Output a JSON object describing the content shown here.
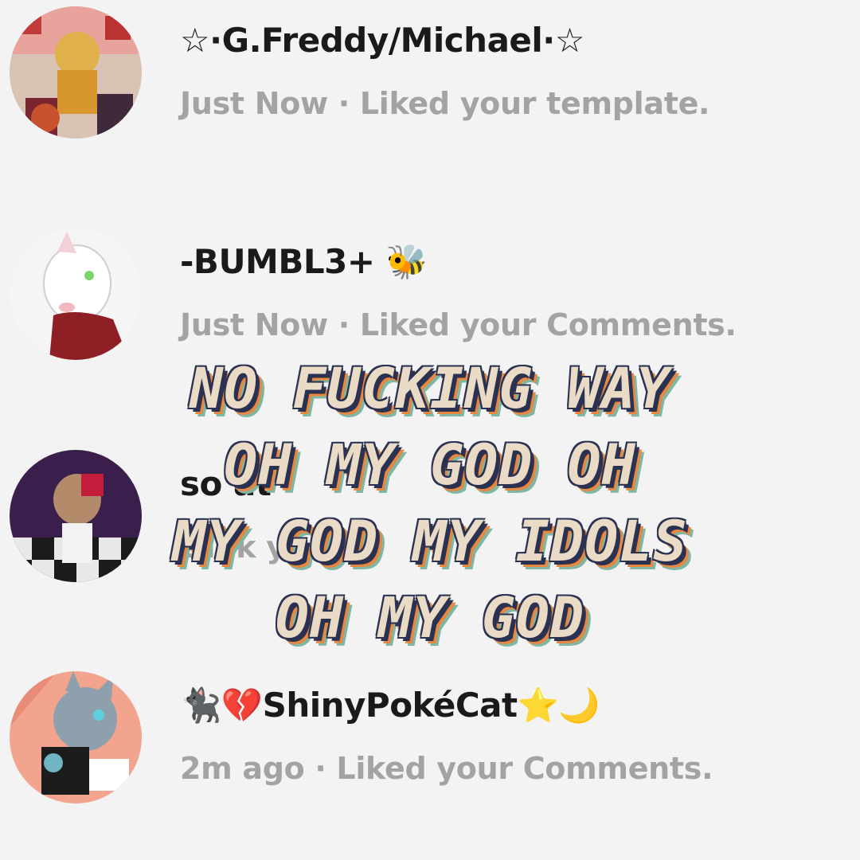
{
  "notifications": [
    {
      "name": "☆·G.Freddy/Michael·☆",
      "meta": "Just Now · Liked your template.",
      "avatar_icon": "avatar-freddy-image"
    },
    {
      "name": "-BUMBL3+ 🐝",
      "meta": "Just Now · Liked your Comments.",
      "avatar_icon": "avatar-white-cat-image"
    },
    {
      "name": "so at",
      "meta": "t I ik yo .",
      "avatar_icon": "avatar-masked-character-image"
    },
    {
      "name": "🐈‍⬛💔ShinyPokéCat⭐🌙",
      "meta": "2m ago · Liked your Comments.",
      "avatar_icon": "avatar-gray-cat-image"
    }
  ],
  "overlay_caption": {
    "lines": [
      "NO FUCKING WAY",
      "OH MY GOD OH",
      "MY GOD MY IDOLS",
      "OH MY GOD"
    ],
    "fill_color": "#eadbc6",
    "outline_color": "#2b3151",
    "shadow_colors": [
      "#e8873f",
      "#7fb7a4"
    ]
  }
}
